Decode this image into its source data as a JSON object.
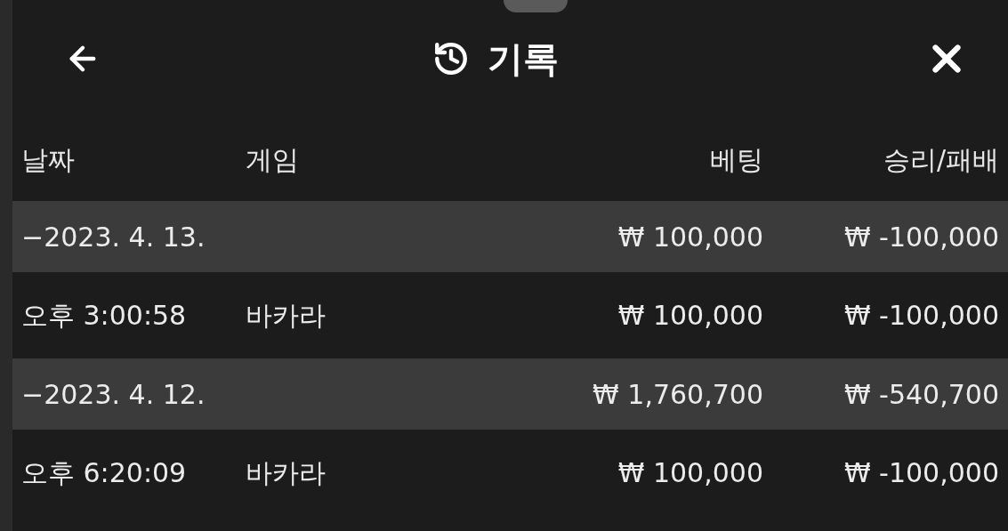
{
  "header": {
    "title": "기록"
  },
  "table": {
    "columns": [
      "날짜",
      "게임",
      "베팅",
      "승리/패배"
    ],
    "rows": [
      {
        "kind": "date",
        "date": "−2023. 4. 13.",
        "bet": "₩ 100,000",
        "result": "₩ -100,000"
      },
      {
        "kind": "entry",
        "date": "오후 3:00:58",
        "game": "바카라",
        "bet": "₩ 100,000",
        "result": "₩ -100,000"
      },
      {
        "kind": "date",
        "date": "−2023. 4. 12.",
        "bet": "₩ 1,760,700",
        "result": "₩ -540,700"
      },
      {
        "kind": "entry",
        "date": "오후 6:20:09",
        "game": "바카라",
        "bet": "₩ 100,000",
        "result": "₩ -100,000"
      }
    ]
  }
}
